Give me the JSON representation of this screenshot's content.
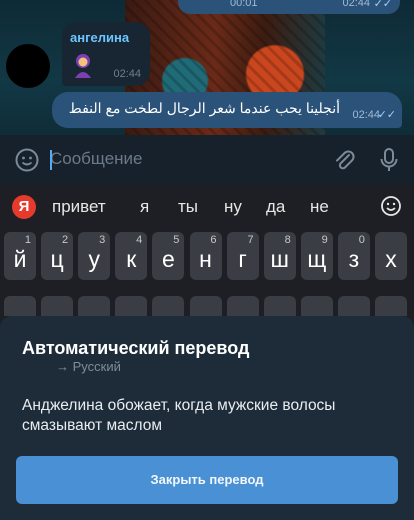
{
  "chat": {
    "top_bubble": {
      "time_left": "00:01",
      "time": "02:44"
    },
    "incoming": {
      "sender": "ангелина",
      "time": "02:44"
    },
    "outgoing": {
      "text": "أنجلينا يحب عندما شعر الرجال لطخت مع النفط",
      "time": "02:44"
    }
  },
  "composer": {
    "placeholder": "Сообщение"
  },
  "suggestions": {
    "logo": "Я",
    "words": [
      "привет",
      "я",
      "ты",
      "ну",
      "да",
      "не"
    ]
  },
  "keyboard": {
    "row1": [
      {
        "ch": "й",
        "num": "1"
      },
      {
        "ch": "ц",
        "num": "2"
      },
      {
        "ch": "у",
        "num": "3"
      },
      {
        "ch": "к",
        "num": "4"
      },
      {
        "ch": "е",
        "num": "5"
      },
      {
        "ch": "н",
        "num": "6"
      },
      {
        "ch": "г",
        "num": "7"
      },
      {
        "ch": "ш",
        "num": "8"
      },
      {
        "ch": "щ",
        "num": "9"
      },
      {
        "ch": "з",
        "num": "0"
      },
      {
        "ch": "х",
        "num": ""
      }
    ]
  },
  "translation": {
    "title": "Автоматический перевод",
    "target_lang": "→ Русский",
    "text": "Анджелина обожает, когда мужские волосы смазывают маслом",
    "close_label": "Закрыть перевод"
  },
  "colors": {
    "accent": "#4a90d4",
    "bubble_out": "#2b5278",
    "bubble_in": "#182533",
    "sender": "#6cc6ff"
  }
}
